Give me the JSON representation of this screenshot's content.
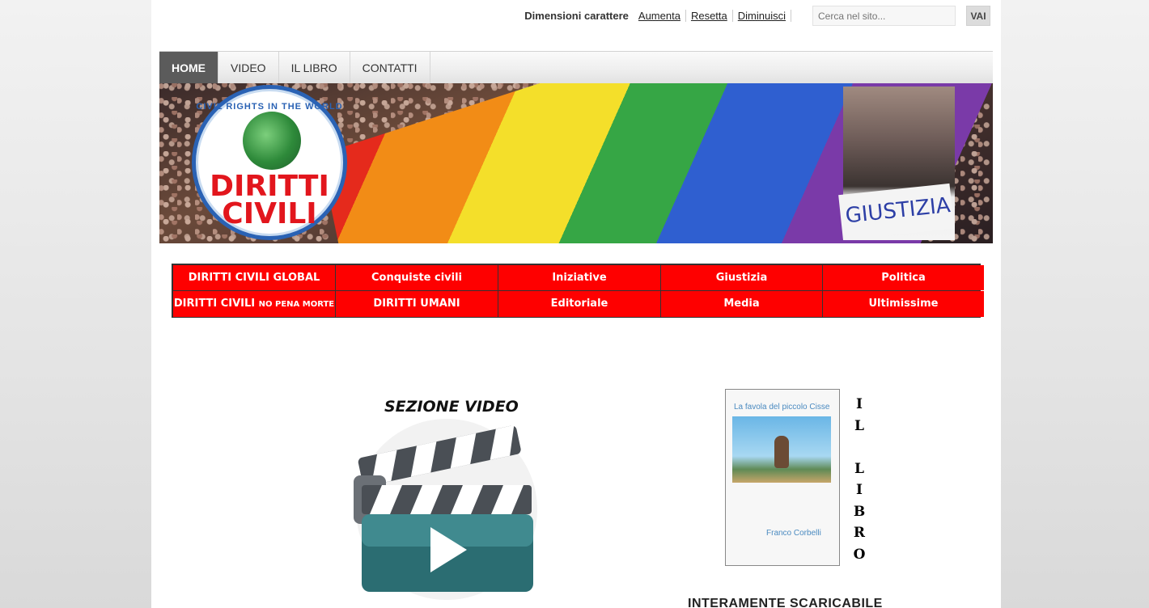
{
  "topbar": {
    "font_size_label": "Dimensioni carattere",
    "font_links": [
      "Aumenta",
      "Resetta",
      "Diminuisci"
    ],
    "search_placeholder": "Cerca nel sito...",
    "search_button": "VAI"
  },
  "nav": {
    "items": [
      {
        "label": "HOME",
        "active": true
      },
      {
        "label": "VIDEO",
        "active": false
      },
      {
        "label": "IL LIBRO",
        "active": false
      },
      {
        "label": "CONTATTI",
        "active": false
      }
    ]
  },
  "banner": {
    "logo_ring_text": "CIVIL RIGHTS IN THE WORLD",
    "logo_name_line1": "DIRITTI",
    "logo_name_line2": "CIVILI",
    "photo_sign": "GIUSTIZIA"
  },
  "categories": {
    "row1": [
      "DIRITTI CIVILI GLOBAL",
      "Conquiste civili",
      "Iniziative",
      "Giustizia",
      "Politica"
    ],
    "row2_first_main": "DIRITTI CIVILI",
    "row2_first_small": "NO PENA MORTE",
    "row2": [
      "DIRITTI UMANI",
      "Editoriale",
      "Media",
      "Ultimissime"
    ],
    "color": "#fe0000"
  },
  "video": {
    "title": "SEZIONE VIDEO"
  },
  "book": {
    "cover_title": "La favola del piccolo Cisse",
    "cover_author": "Franco Corbelli",
    "side_letters": [
      "I",
      "L",
      "",
      "L",
      "I",
      "B",
      "R",
      "O"
    ],
    "download_text": "INTERAMENTE SCARICABILE"
  }
}
